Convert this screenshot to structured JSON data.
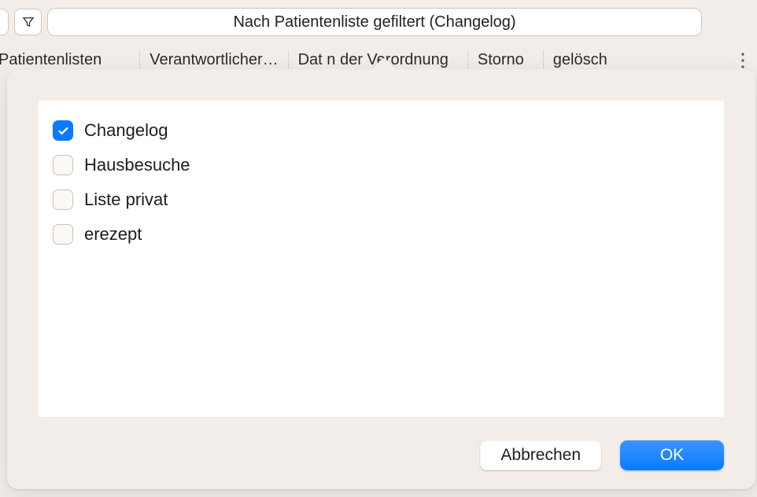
{
  "toolbar": {
    "search_text": "Nach Patientenliste gefiltert (Changelog)"
  },
  "columns": {
    "c0": "Patientenlisten",
    "c1": "Verantwortlicher…",
    "c2": "Dat      n der Verordnung",
    "c3": "Storno",
    "c4": "gelösch"
  },
  "popover": {
    "items": [
      {
        "label": "Changelog",
        "checked": true
      },
      {
        "label": "Hausbesuche",
        "checked": false
      },
      {
        "label": "Liste privat",
        "checked": false
      },
      {
        "label": "erezept",
        "checked": false
      }
    ],
    "cancel_label": "Abbrechen",
    "ok_label": "OK"
  }
}
